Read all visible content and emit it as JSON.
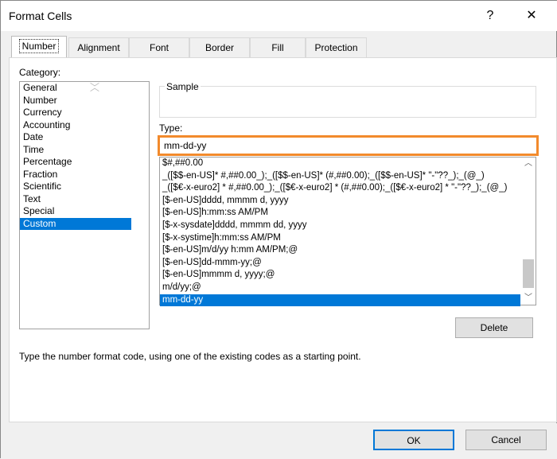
{
  "window": {
    "title": "Format Cells",
    "help": "?",
    "close": "✕"
  },
  "tabs": [
    "Number",
    "Alignment",
    "Font",
    "Border",
    "Fill",
    "Protection"
  ],
  "category": {
    "label": "Category:",
    "items": [
      "General",
      "Number",
      "Currency",
      "Accounting",
      "Date",
      "Time",
      "Percentage",
      "Fraction",
      "Scientific",
      "Text",
      "Special",
      "Custom"
    ],
    "selected": "Custom"
  },
  "sample": {
    "label": "Sample"
  },
  "type": {
    "label": "Type:",
    "value": "mm-dd-yy",
    "items": [
      "$#,##0.00",
      "_([$$-en-US]* #,##0.00_);_([$$-en-US]* (#,##0.00);_([$$-en-US]* \"-\"??_);_(@_)",
      "_([$€-x-euro2] * #,##0.00_);_([$€-x-euro2] * (#,##0.00);_([$€-x-euro2] * \"-\"??_);_(@_)",
      "[$-en-US]dddd, mmmm d, yyyy",
      "[$-en-US]h:mm:ss AM/PM",
      "[$-x-sysdate]dddd, mmmm dd, yyyy",
      "[$-x-systime]h:mm:ss AM/PM",
      "[$-en-US]m/d/yy h:mm AM/PM;@",
      "[$-en-US]dd-mmm-yy;@",
      "[$-en-US]mmmm d, yyyy;@",
      "m/d/yy;@",
      "mm-dd-yy"
    ],
    "selected": "mm-dd-yy"
  },
  "delete_label": "Delete",
  "hint": "Type the number format code, using one of the existing codes as a starting point.",
  "ok_label": "OK",
  "cancel_label": "Cancel",
  "colors": {
    "highlight": "#0078d7",
    "type_outline": "#f28a2c"
  }
}
